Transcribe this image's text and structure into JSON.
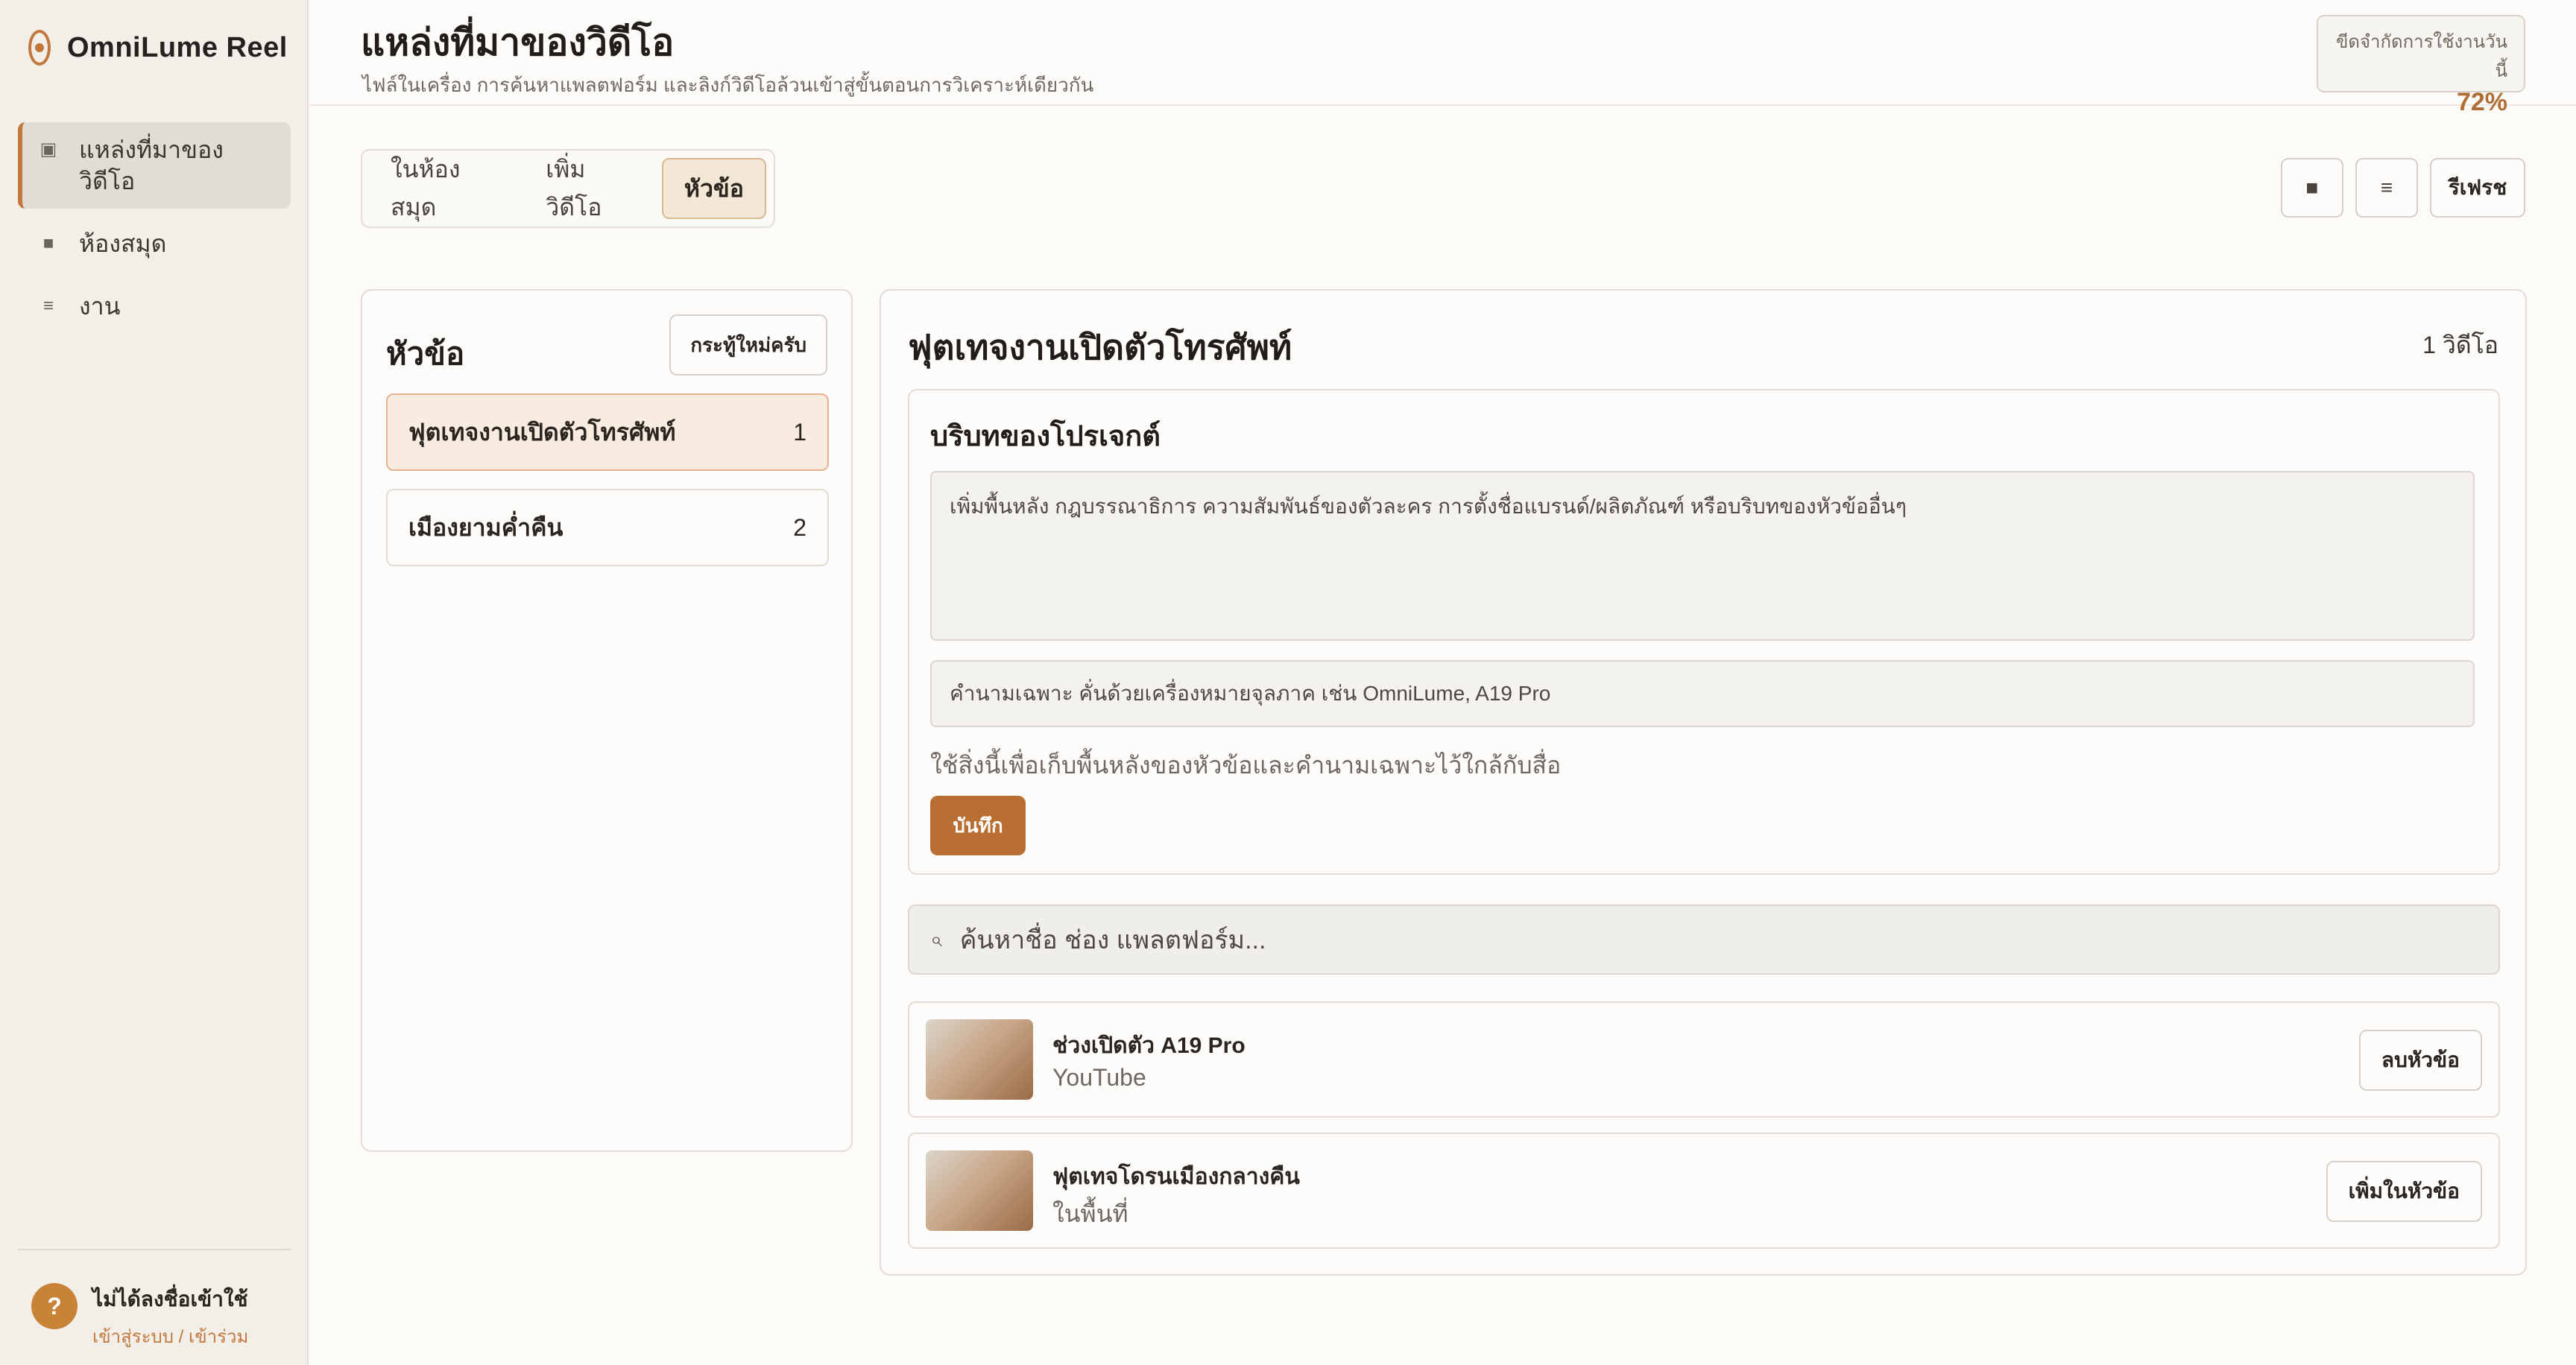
{
  "app": {
    "name": "OmniLume Reel"
  },
  "sidebar": {
    "items": [
      {
        "label": "แหล่งที่มาของวิดีโอ",
        "icon": "source-icon"
      },
      {
        "label": "ห้องสมุด",
        "icon": "library-icon"
      },
      {
        "label": "งาน",
        "icon": "jobs-icon"
      }
    ],
    "user": {
      "avatar": "?",
      "name": "ไม่ได้ลงชื่อเข้าใช้",
      "link": "เข้าสู่ระบบ / เข้าร่วม"
    }
  },
  "header": {
    "title": "แหล่งที่มาของวิดีโอ",
    "subtitle": "ไฟล์ในเครื่อง การค้นหาแพลตฟอร์ม และลิงก์วิดีโอล้วนเข้าสู่ขั้นตอนการวิเคราะห์เดียวกัน",
    "quota_label": "ขีดจำกัดการใช้งานวันนี้",
    "quota_value": "72%"
  },
  "tabs": [
    {
      "label": "ในห้องสมุด"
    },
    {
      "label": "เพิ่มวิดีโอ"
    },
    {
      "label": "หัวข้อ"
    }
  ],
  "toolbar": {
    "grid_icon": "■",
    "list_icon": "≡",
    "refresh_label": "รีเฟรช"
  },
  "topics": {
    "title": "หัวข้อ",
    "new_button": "กระทู้ใหม่ครับ",
    "items": [
      {
        "name": "ฟุตเทจงานเปิดตัวโทรศัพท์",
        "count": "1"
      },
      {
        "name": "เมืองยามค่ำคืน",
        "count": "2"
      }
    ]
  },
  "detail": {
    "title": "ฟุตเทจงานเปิดตัวโทรศัพท์",
    "count": "1 วิดีโอ",
    "context": {
      "title": "บริบทของโปรเจกต์",
      "textarea_placeholder": "เพิ่มพื้นหลัง กฎบรรณาธิการ ความสัมพันธ์ของตัวละคร การตั้งชื่อแบรนด์/ผลิตภัณฑ์ หรือบริบทของหัวข้ออื่นๆ",
      "proper_nouns_placeholder": "คำนามเฉพาะ คั่นด้วยเครื่องหมายจุลภาค เช่น OmniLume, A19 Pro",
      "hint": "ใช้สิ่งนี้เพื่อเก็บพื้นหลังของหัวข้อและคำนามเฉพาะไว้ใกล้กับสื่อ",
      "save_label": "บันทึก"
    },
    "search": {
      "icon": "⌕",
      "placeholder": "ค้นหาชื่อ ช่อง แพลตฟอร์ม..."
    },
    "videos": [
      {
        "title": "ช่วงเปิดตัว A19 Pro",
        "source": "YouTube",
        "action": "ลบหัวข้อ"
      },
      {
        "title": "ฟุตเทจโดรนเมืองกลางคืน",
        "source": "ในพื้นที่",
        "action": "เพิ่มในหัวข้อ"
      }
    ]
  },
  "colors": {
    "accent": "#c2773c",
    "save_button": "#b96f34",
    "quota_value": "#b06d36",
    "active_topic_bg": "#f8ebe0"
  }
}
